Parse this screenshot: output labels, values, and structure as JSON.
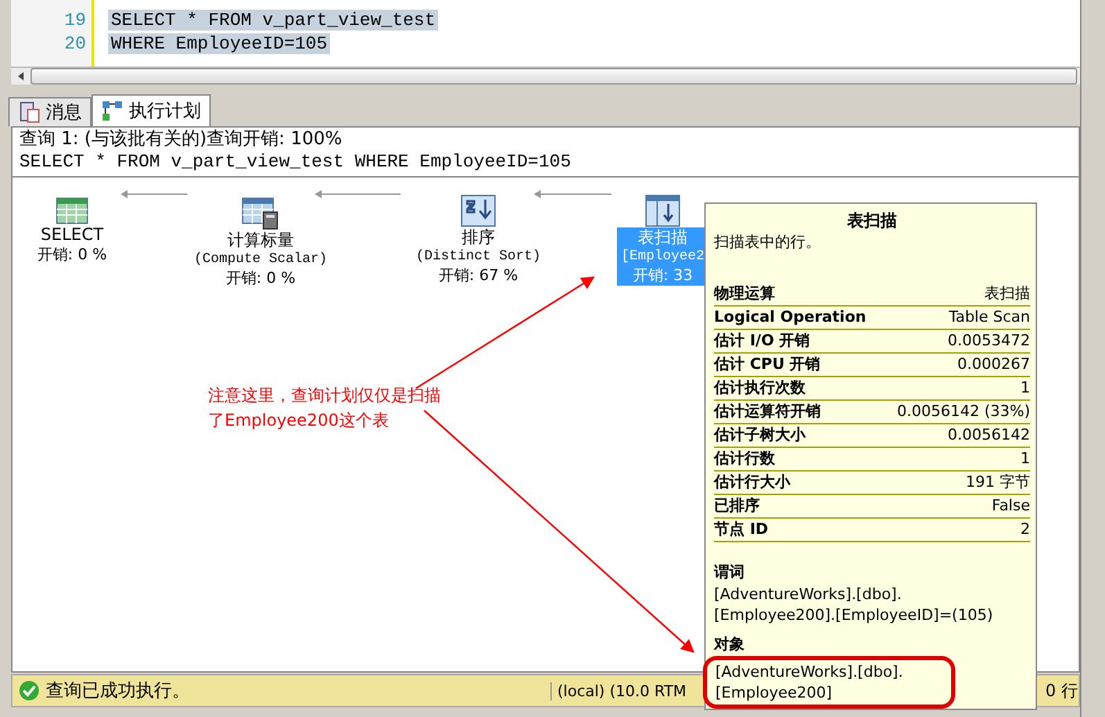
{
  "editor": {
    "lines": [
      {
        "number": "19",
        "text": "SELECT * FROM v_part_view_test",
        "selected": true
      },
      {
        "number": "20",
        "text": "WHERE EmployeeID=105",
        "selected": true
      }
    ]
  },
  "tabs": [
    {
      "label": "消息",
      "selected": false
    },
    {
      "label": "执行计划",
      "selected": true
    }
  ],
  "plan": {
    "header_lines": [
      "查询 1: (与该批有关的)查询开销: 100%",
      "SELECT * FROM v_part_view_test WHERE EmployeeID=105"
    ],
    "nodes": [
      {
        "kind": "select",
        "title": "SELECT",
        "cost": "开销: 0 %",
        "selected": false
      },
      {
        "kind": "compute",
        "title": "计算标量",
        "subtitle": "(Compute Scalar)",
        "cost": "开销: 0 %",
        "selected": false
      },
      {
        "kind": "sort",
        "title": "排序",
        "subtitle": "(Distinct Sort)",
        "cost": "开销: 67 %",
        "selected": false
      },
      {
        "kind": "scan",
        "title": "表扫描",
        "subtitle": "[Employee2",
        "cost": "开销: 33",
        "selected": true
      }
    ]
  },
  "annotation": {
    "text": "注意这里，查询计划仅仅是扫描了Employee200这个表"
  },
  "tooltip": {
    "title": "表扫描",
    "description": "扫描表中的行。",
    "properties": [
      {
        "label": "物理运算",
        "value": "表扫描"
      },
      {
        "label": "Logical Operation",
        "value": "Table Scan"
      },
      {
        "label": "估计 I/O 开销",
        "value": "0.0053472"
      },
      {
        "label": "估计 CPU 开销",
        "value": "0.000267"
      },
      {
        "label": "估计执行次数",
        "value": "1"
      },
      {
        "label": "估计运算符开销",
        "value": "0.0056142 (33%)"
      },
      {
        "label": "估计子树大小",
        "value": "0.0056142"
      },
      {
        "label": "估计行数",
        "value": "1"
      },
      {
        "label": "估计行大小",
        "value": "191 字节"
      },
      {
        "label": "已排序",
        "value": "False"
      },
      {
        "label": "节点 ID",
        "value": "2"
      }
    ],
    "sections": [
      {
        "heading": "谓词",
        "text": "[AdventureWorks].[dbo].\n[Employee200].[EmployeeID]=(105)",
        "highlighted": false
      },
      {
        "heading": "对象",
        "text": "[AdventureWorks].[dbo].\n[Employee200]",
        "highlighted": true
      }
    ]
  },
  "status_bar": {
    "message": "查询已成功执行。",
    "server": "(local) (10.0 RTM",
    "rows": "0 行"
  }
}
